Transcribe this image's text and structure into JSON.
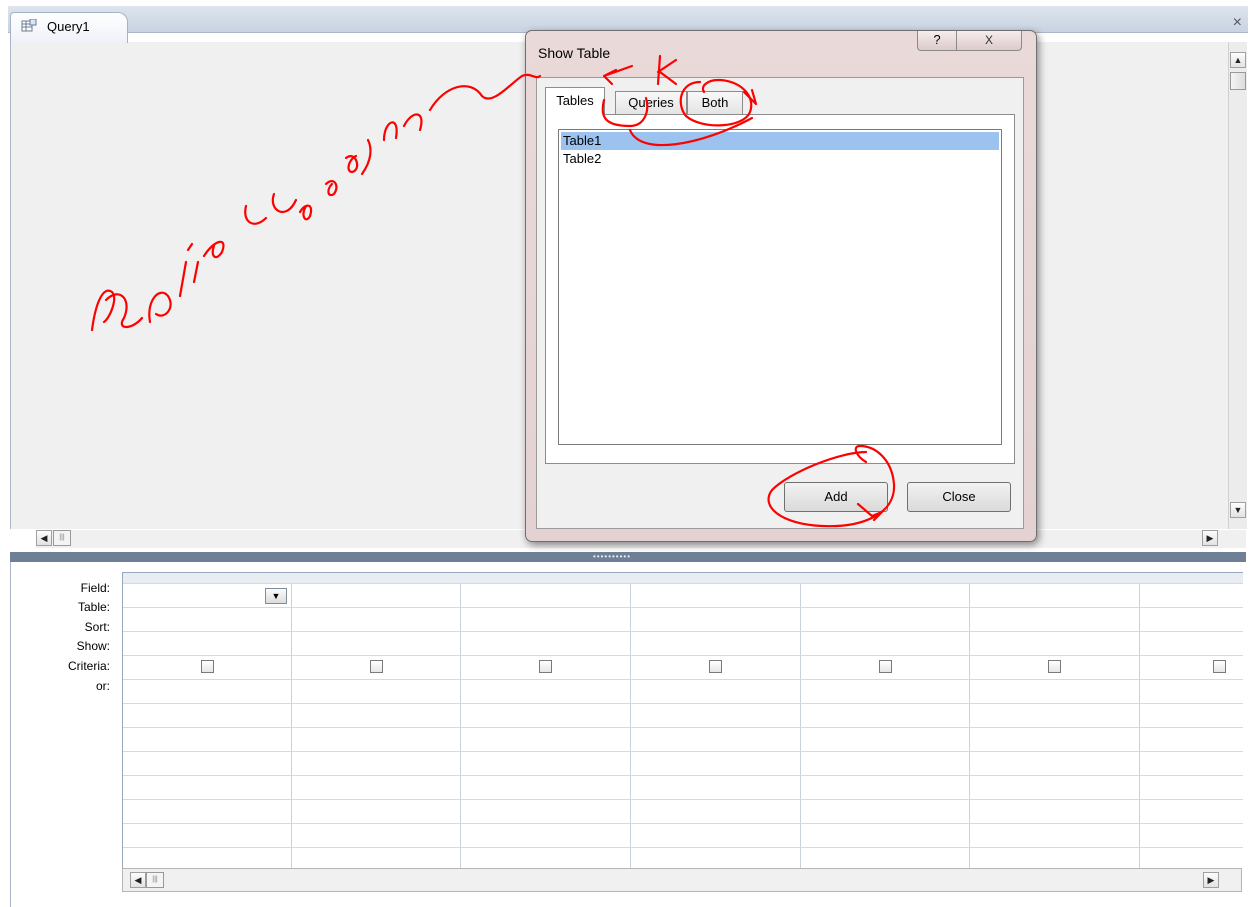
{
  "window": {
    "tab_title": "Query1",
    "close_glyph": "×"
  },
  "qbe": {
    "row_labels": [
      "Field:",
      "Table:",
      "Sort:",
      "Show:",
      "Criteria:",
      "or:"
    ],
    "column_count": 7,
    "show_checked": [
      false,
      false,
      false,
      false,
      false,
      false,
      false
    ]
  },
  "dialog": {
    "title": "Show Table",
    "help_glyph": "?",
    "close_glyph": "X",
    "tabs": [
      "Tables",
      "Queries",
      "Both"
    ],
    "active_tab": "Tables",
    "tables": [
      "Table1",
      "Table2"
    ],
    "selected_table": "Table1",
    "add_label": "Add",
    "close_label": "Close"
  },
  "annotation": {
    "color": "#ff0000"
  },
  "icons": {
    "tab": "query-icon",
    "scroll_up": "▲",
    "scroll_down": "▼",
    "scroll_left": "◀",
    "scroll_right": "▶",
    "dropdown": "▼",
    "thumb": "|||"
  }
}
